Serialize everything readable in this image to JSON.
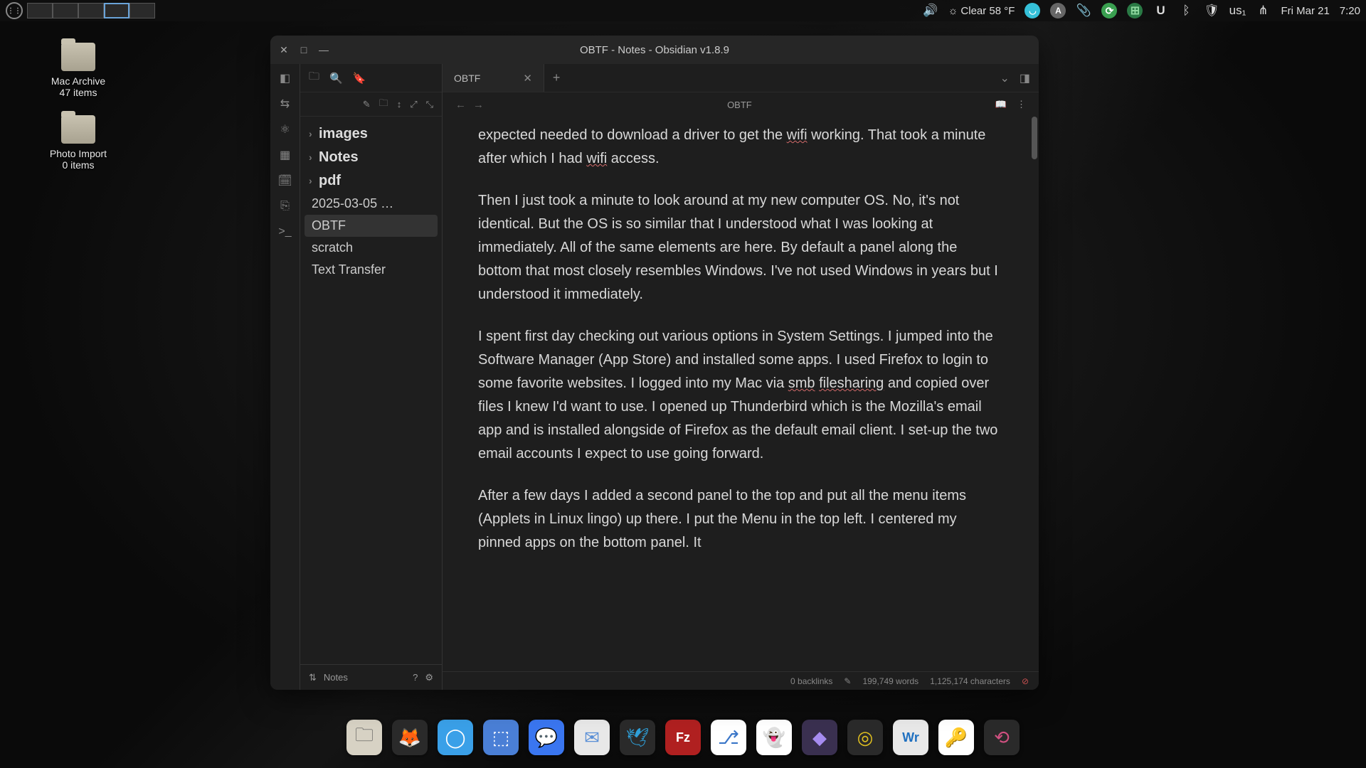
{
  "panel": {
    "weather_text": "Clear 58 °F",
    "keyboard_layout": "us₁",
    "date": "Fri  Mar 21",
    "time": "7:20"
  },
  "desktop": {
    "icons": [
      {
        "name": "Mac Archive",
        "sub": "47 items"
      },
      {
        "name": "Photo Import",
        "sub": "0 items"
      }
    ]
  },
  "window": {
    "title": "OBTF - Notes - Obsidian v1.8.9",
    "tab_label": "OBTF",
    "breadcrumb": "OBTF"
  },
  "tree": {
    "folders": [
      "images",
      "Notes",
      "pdf"
    ],
    "files": [
      "2025-03-05 …",
      "OBTF",
      "scratch",
      "Text Transfer"
    ],
    "active": "OBTF",
    "vault_name": "Notes"
  },
  "note": {
    "p1a": "expected needed to download a driver to get the ",
    "p1_wifi1": "wifi",
    "p1b": " working. That took a minute after which I had ",
    "p1_wifi2": "wifi",
    "p1c": " access.",
    "p2": "Then I just took a minute to look around at my new computer OS. No, it's not identical. But the OS is so similar that I understood what I was looking at immediately. All of the same elements are here. By default a panel along the bottom that most closely resembles Windows. I've not used Windows in years but I understood it immediately.",
    "p3a": "I spent first day checking out various options in System Settings. I jumped into the Software Manager (App Store) and installed some apps. I used Firefox to login to some favorite websites. I logged into my Mac via ",
    "p3_smb": "smb",
    "p3_sp": " ",
    "p3_fs": "filesharing",
    "p3b": " and copied over files I knew I'd want to use. I opened up Thunderbird which is the Mozilla's email app and is installed alongside of Firefox as the default email client. I set-up the two email accounts I expect to use going forward.",
    "p4": "After a few days I added a second panel to the top and put all the menu items (Applets in Linux lingo) up there. I put the Menu in the top left.  I centered my pinned apps on the bottom panel.  It"
  },
  "status": {
    "backlinks": "0 backlinks",
    "words": "199,749 words",
    "chars": "1,125,174 characters"
  },
  "dock": [
    {
      "name": "files",
      "bg": "#d7d2c4",
      "glyph": "🗀",
      "fg": "#555"
    },
    {
      "name": "firefox",
      "bg": "#2a2a2a",
      "glyph": "🦊",
      "fg": "#ff7139"
    },
    {
      "name": "librewolf",
      "bg": "#3aa0e8",
      "glyph": "◯",
      "fg": "#fff"
    },
    {
      "name": "screenshot",
      "bg": "#4a7fd6",
      "glyph": "⬚",
      "fg": "#fff"
    },
    {
      "name": "signal",
      "bg": "#3a76f0",
      "glyph": "💬",
      "fg": "#fff"
    },
    {
      "name": "mail",
      "bg": "#e8e8e8",
      "glyph": "✉",
      "fg": "#5a8fd6"
    },
    {
      "name": "thunderbird",
      "bg": "#2a2a2a",
      "glyph": "🕊",
      "fg": "#2f9fd8"
    },
    {
      "name": "filezilla",
      "bg": "#b02020",
      "glyph": "Fz",
      "fg": "#fff"
    },
    {
      "name": "remmina",
      "bg": "#fff",
      "glyph": "⎇",
      "fg": "#3a76c8"
    },
    {
      "name": "ghostwriter",
      "bg": "#fff",
      "glyph": "👻",
      "fg": "#333"
    },
    {
      "name": "obsidian",
      "bg": "#3a3050",
      "glyph": "◆",
      "fg": "#a68cf0"
    },
    {
      "name": "rhythmbox",
      "bg": "#2a2a2a",
      "glyph": "◎",
      "fg": "#e0c020"
    },
    {
      "name": "writer",
      "bg": "#e8e8e8",
      "glyph": "Wr",
      "fg": "#2070c0"
    },
    {
      "name": "keepass",
      "bg": "#fff",
      "glyph": "🔑",
      "fg": "#3a9040"
    },
    {
      "name": "sync",
      "bg": "#2a2a2a",
      "glyph": "⟲",
      "fg": "#d05080"
    }
  ]
}
